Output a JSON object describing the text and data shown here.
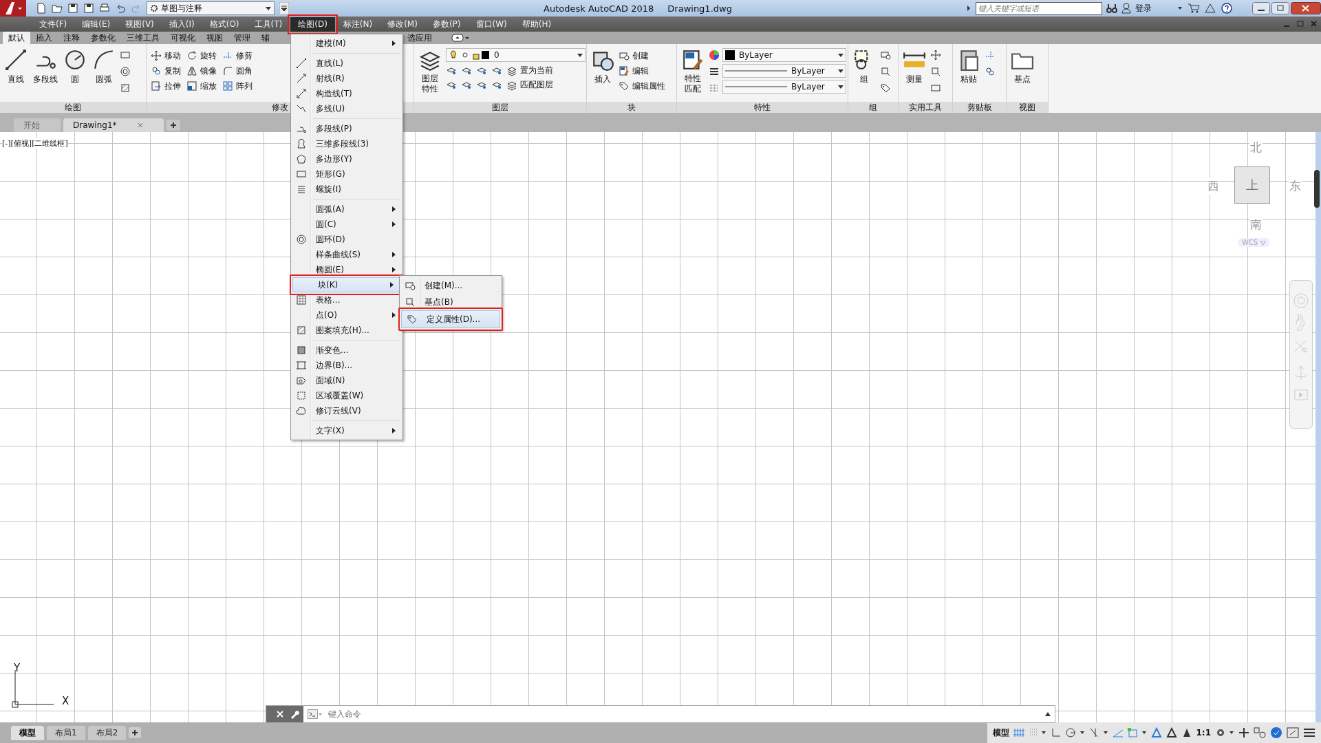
{
  "title_bar": {
    "workspace": "草图与注释",
    "title": "Autodesk AutoCAD 2018",
    "file": "Drawing1.dwg",
    "search": {
      "placeholder": "键入关键字或短语"
    },
    "login": "登录"
  },
  "menu_bar": [
    {
      "label": "文件(F)",
      "selected": false
    },
    {
      "label": "编辑(E)",
      "selected": false
    },
    {
      "label": "视图(V)",
      "selected": false
    },
    {
      "label": "插入(I)",
      "selected": false
    },
    {
      "label": "格式(O)",
      "selected": false
    },
    {
      "label": "工具(T)",
      "selected": false
    },
    {
      "label": "绘图(D)",
      "selected": true
    },
    {
      "label": "标注(N)",
      "selected": false
    },
    {
      "label": "修改(M)",
      "selected": false
    },
    {
      "label": "参数(P)",
      "selected": false
    },
    {
      "label": "窗口(W)",
      "selected": false
    },
    {
      "label": "帮助(H)",
      "selected": false
    }
  ],
  "ribbon_tabs": [
    {
      "label": "默认",
      "selected": true
    },
    {
      "label": "插入",
      "selected": false
    },
    {
      "label": "注释",
      "selected": false
    },
    {
      "label": "参数化",
      "selected": false
    },
    {
      "label": "三维工具",
      "selected": false
    },
    {
      "label": "可视化",
      "selected": false
    },
    {
      "label": "视图",
      "selected": false
    },
    {
      "label": "管理",
      "selected": false
    },
    {
      "label": "辅",
      "selected": false
    },
    {
      "label": "选应用",
      "selected": false
    }
  ],
  "ribbon_panels": [
    {
      "title": "绘图",
      "large": [
        "直线",
        "多段线",
        "圆",
        "圆弧"
      ]
    },
    {
      "title": "修改",
      "small": [
        "移动",
        "旋转",
        "修剪",
        "复制",
        "镜像",
        "圆角",
        "拉伸",
        "缩放",
        "阵列"
      ]
    },
    {
      "title": "图层",
      "large": [
        "图层特性"
      ],
      "dropdowns": [
        "0"
      ],
      "small": [
        "置为当前",
        "匹配图层"
      ]
    },
    {
      "title": "块",
      "large": [
        "插入"
      ],
      "small": [
        "创建",
        "编辑",
        "编辑属性"
      ]
    },
    {
      "title": "特性",
      "large": [
        "特性匹配"
      ],
      "dropdowns": [
        "ByLayer",
        "ByLayer",
        "ByLayer"
      ]
    },
    {
      "title": "组",
      "large": [
        "组"
      ]
    },
    {
      "title": "实用工具",
      "large": [
        "测量"
      ]
    },
    {
      "title": "剪贴板",
      "large": [
        "粘贴"
      ]
    },
    {
      "title": "视图",
      "large": [
        "基点"
      ]
    }
  ],
  "file_tabs": [
    {
      "label": "开始",
      "selected": false
    },
    {
      "label": "Drawing1*",
      "selected": true
    }
  ],
  "viewport_label": "[-][俯视][二维线框]",
  "draw_menu": [
    {
      "kind": "item",
      "label": "建模(M)",
      "submenu": true,
      "selected": false
    },
    {
      "kind": "separator"
    },
    {
      "kind": "item",
      "label": "直线(L)",
      "submenu": false,
      "selected": false
    },
    {
      "kind": "item",
      "label": "射线(R)",
      "submenu": false,
      "selected": false
    },
    {
      "kind": "item",
      "label": "构造线(T)",
      "submenu": false,
      "selected": false
    },
    {
      "kind": "item",
      "label": "多线(U)",
      "submenu": false,
      "selected": false
    },
    {
      "kind": "separator"
    },
    {
      "kind": "item",
      "label": "多段线(P)",
      "submenu": false,
      "selected": false
    },
    {
      "kind": "item",
      "label": "三维多段线(3)",
      "submenu": false,
      "selected": false
    },
    {
      "kind": "item",
      "label": "多边形(Y)",
      "submenu": false,
      "selected": false
    },
    {
      "kind": "item",
      "label": "矩形(G)",
      "submenu": false,
      "selected": false
    },
    {
      "kind": "item",
      "label": "螺旋(I)",
      "submenu": false,
      "selected": false
    },
    {
      "kind": "separator"
    },
    {
      "kind": "item",
      "label": "圆弧(A)",
      "submenu": true,
      "selected": false
    },
    {
      "kind": "item",
      "label": "圆(C)",
      "submenu": true,
      "selected": false
    },
    {
      "kind": "item",
      "label": "圆环(D)",
      "submenu": false,
      "selected": false
    },
    {
      "kind": "item",
      "label": "样条曲线(S)",
      "submenu": true,
      "selected": false
    },
    {
      "kind": "item",
      "label": "椭圆(E)",
      "submenu": true,
      "selected": false
    },
    {
      "kind": "item",
      "label": "块(K)",
      "submenu": true,
      "selected": true
    },
    {
      "kind": "item",
      "label": "表格...",
      "submenu": false,
      "selected": false
    },
    {
      "kind": "item",
      "label": "点(O)",
      "submenu": true,
      "selected": false
    },
    {
      "kind": "item",
      "label": "图案填充(H)...",
      "submenu": false,
      "selected": false
    },
    {
      "kind": "separator"
    },
    {
      "kind": "item",
      "label": "渐变色...",
      "submenu": false,
      "selected": false
    },
    {
      "kind": "item",
      "label": "边界(B)...",
      "submenu": false,
      "selected": false
    },
    {
      "kind": "item",
      "label": "面域(N)",
      "submenu": false,
      "selected": false
    },
    {
      "kind": "item",
      "label": "区域覆盖(W)",
      "submenu": false,
      "selected": false
    },
    {
      "kind": "item",
      "label": "修订云线(V)",
      "submenu": false,
      "selected": false
    },
    {
      "kind": "separator"
    },
    {
      "kind": "item",
      "label": "文字(X)",
      "submenu": true,
      "selected": false
    }
  ],
  "block_submenu": [
    {
      "label": "创建(M)...",
      "selected": false
    },
    {
      "label": "基点(B)",
      "selected": false
    },
    {
      "label": "定义属性(D)...",
      "selected": true
    }
  ],
  "viewcube": {
    "north": "北",
    "west": "西",
    "east": "东",
    "south": "南",
    "face": "上",
    "coords": "WCS"
  },
  "ucs": {
    "y": "Y",
    "x": "X"
  },
  "command_line": {
    "placeholder": "键入命令"
  },
  "layout_tabs": [
    {
      "label": "模型",
      "selected": true
    },
    {
      "label": "布局1",
      "selected": false
    },
    {
      "label": "布局2",
      "selected": false
    }
  ],
  "status_bar": {
    "space": "模型",
    "scale": "1:1"
  }
}
